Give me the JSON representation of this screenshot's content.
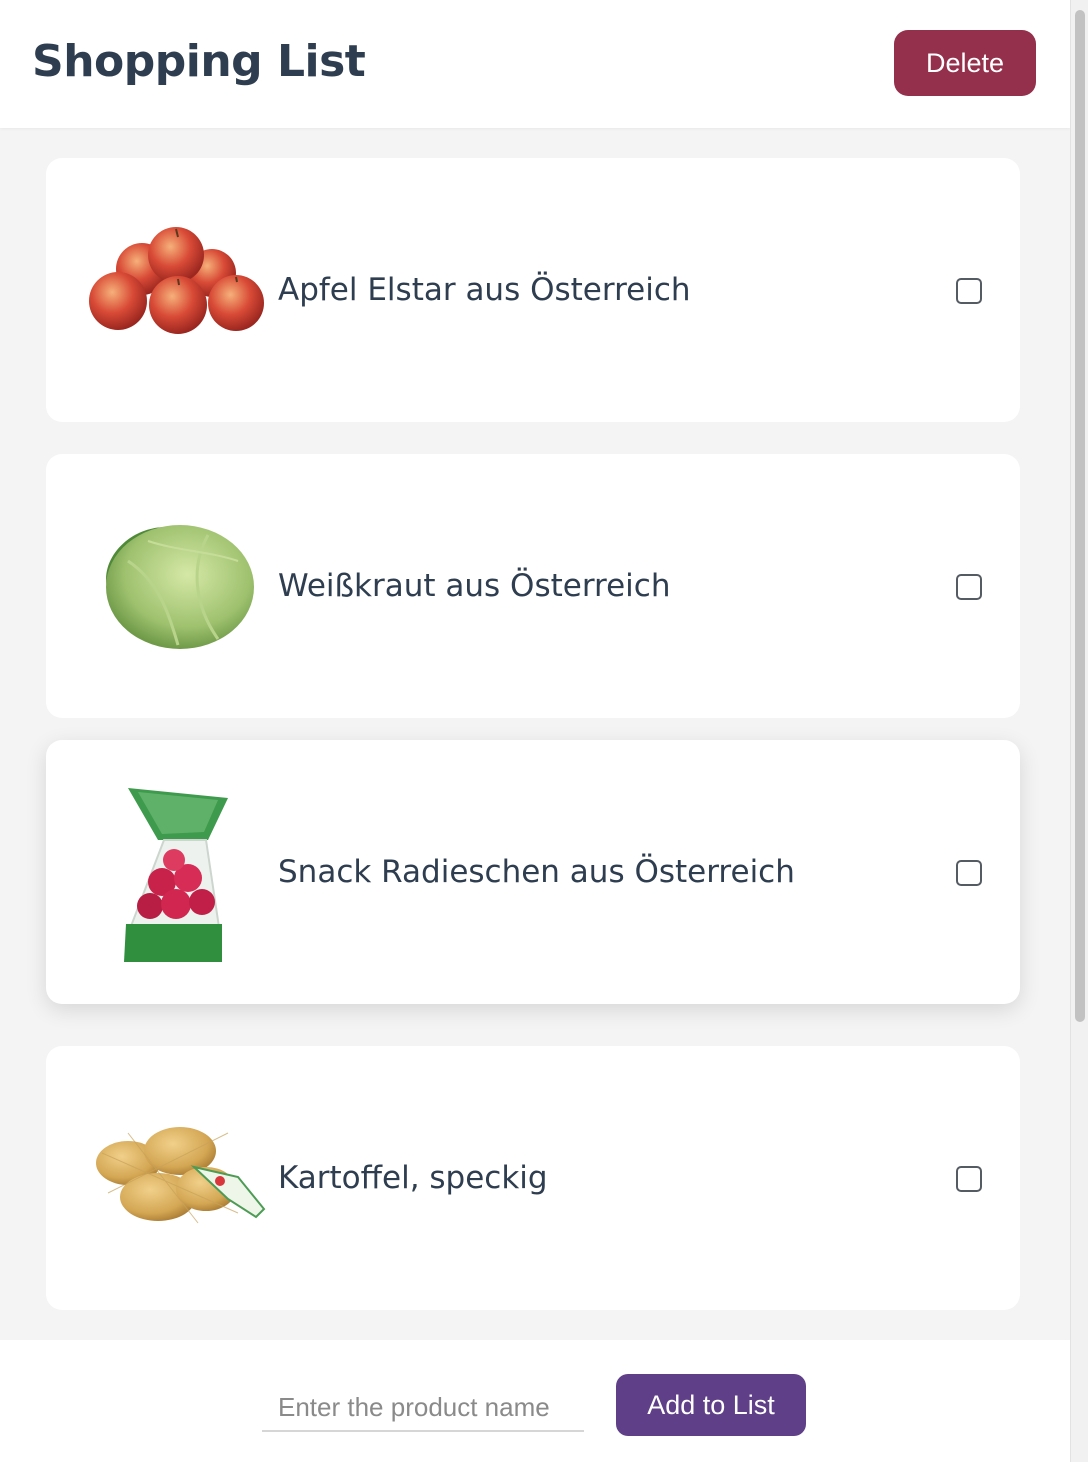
{
  "header": {
    "title": "Shopping List",
    "delete_label": "Delete"
  },
  "items": [
    {
      "name": "Apfel Elstar aus Österreich",
      "checked": false,
      "image": "apples-image"
    },
    {
      "name": "Weißkraut aus Österreich",
      "checked": false,
      "image": "cabbage-image"
    },
    {
      "name": "Snack Radieschen aus Österreich",
      "checked": false,
      "image": "radish-bag-image"
    },
    {
      "name": "Kartoffel, speckig",
      "checked": false,
      "image": "potatoes-net-image"
    }
  ],
  "footer": {
    "input_placeholder": "Enter the product name",
    "input_value": "",
    "add_label": "Add to List"
  },
  "colors": {
    "title": "#2e3d4f",
    "delete_button": "#94304c",
    "add_button": "#5f3f87",
    "background": "#f4f4f4"
  }
}
